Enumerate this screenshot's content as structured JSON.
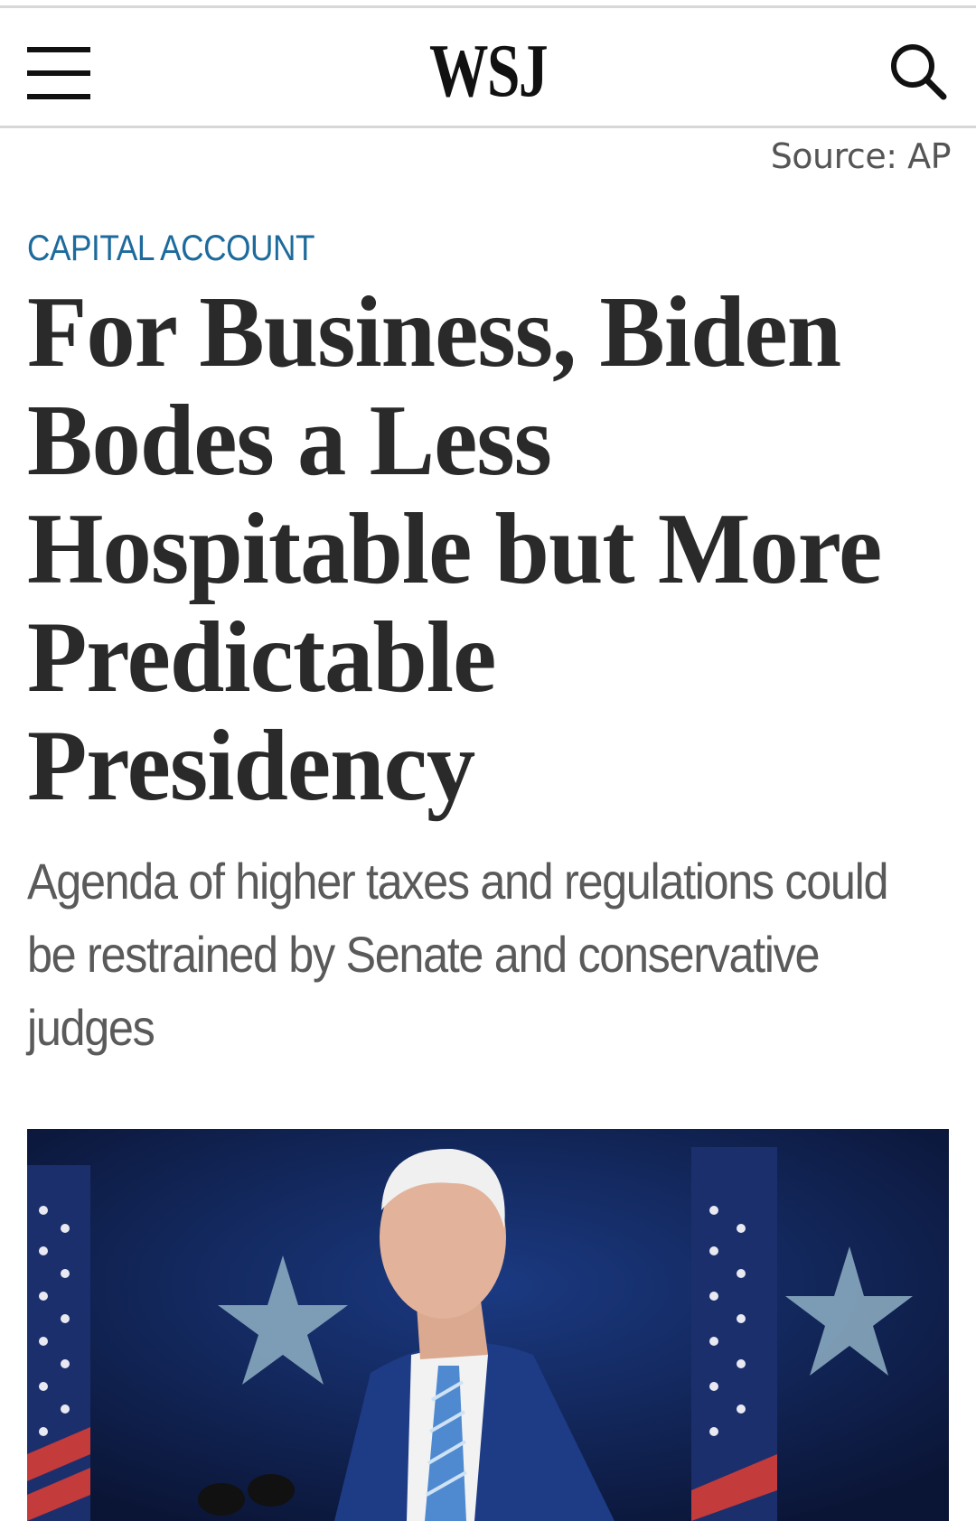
{
  "header": {
    "logo": "WSJ",
    "menu_icon": "hamburger-menu-icon",
    "search_icon": "search-icon"
  },
  "article": {
    "photo_credit": "Source: AP",
    "section": "CAPITAL ACCOUNT",
    "headline": "For Business, Biden Bodes a Less Hospitable but More Predictable Presidency",
    "dek": "Agenda of higher taxes and regulations could be restrained by Senate and conservative judges"
  },
  "colors": {
    "section_label": "#1d6b9c",
    "headline": "#2a2a2a",
    "dek": "#5a5a5a",
    "photo_background": "#0e1b44"
  }
}
